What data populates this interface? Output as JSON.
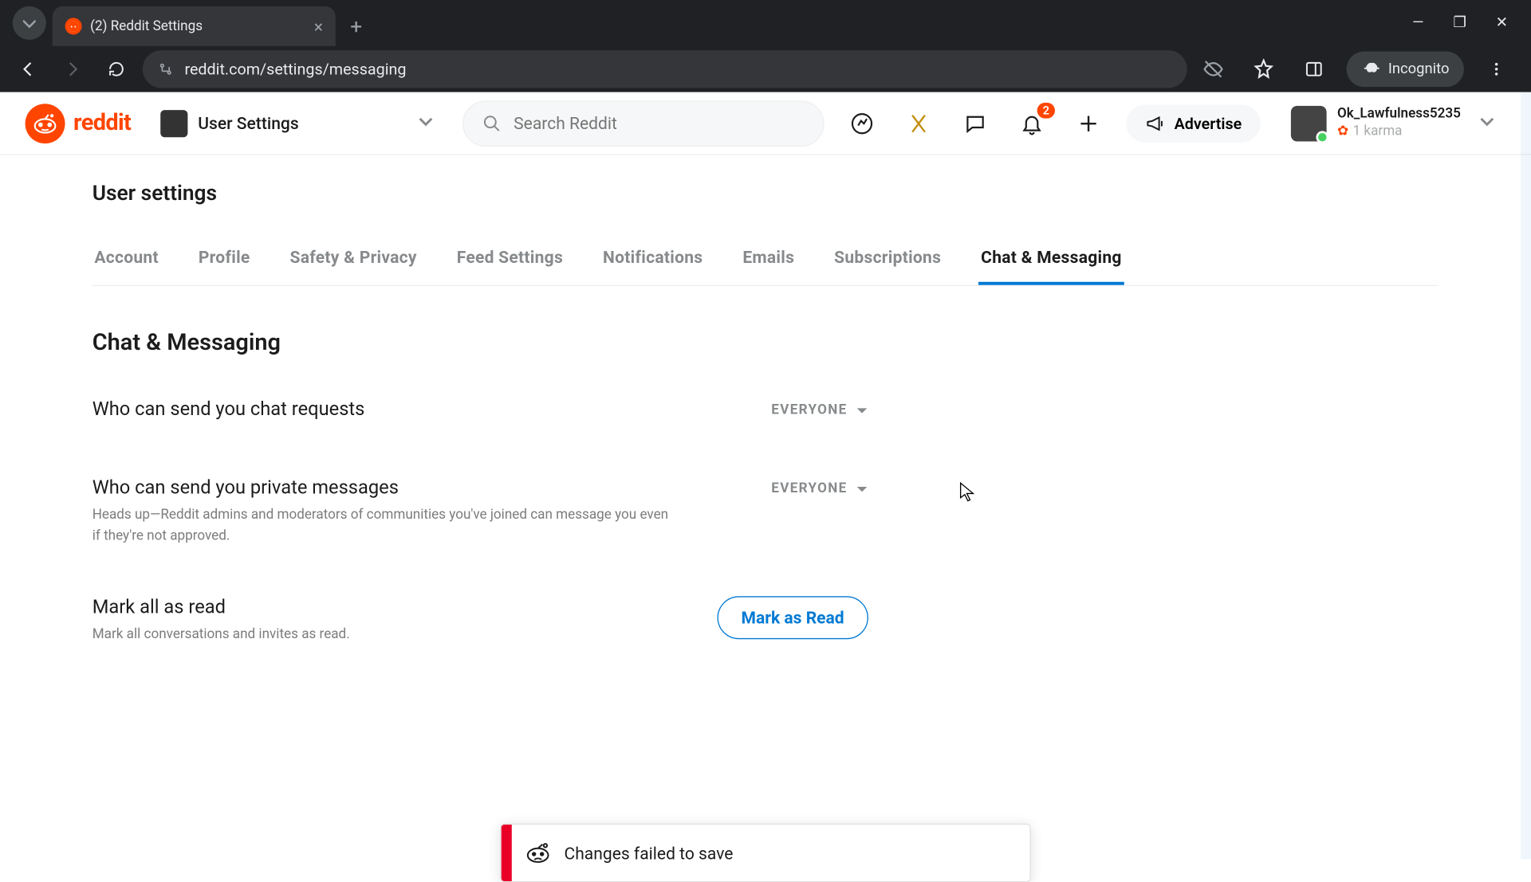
{
  "browser": {
    "tab_title": "(2) Reddit Settings",
    "url": "reddit.com/settings/messaging",
    "incognito_label": "Incognito"
  },
  "header": {
    "logo_text": "reddit",
    "nav_label": "User Settings",
    "search_placeholder": "Search Reddit",
    "notification_count": "2",
    "advertise_label": "Advertise",
    "user_name": "Ok_Lawfulness5235",
    "user_karma": "1 karma"
  },
  "page": {
    "title": "User settings",
    "tabs": [
      "Account",
      "Profile",
      "Safety & Privacy",
      "Feed Settings",
      "Notifications",
      "Emails",
      "Subscriptions",
      "Chat & Messaging"
    ],
    "active_tab_index": 7,
    "section_title": "Chat & Messaging",
    "settings": {
      "chat_requests": {
        "label": "Who can send you chat requests",
        "value": "EVERYONE"
      },
      "private_messages": {
        "label": "Who can send you private messages",
        "desc": "Heads up—Reddit admins and moderators of communities you've joined can message you even if they're not approved.",
        "value": "EVERYONE"
      },
      "mark_read": {
        "label": "Mark all as read",
        "desc": "Mark all conversations and invites as read.",
        "button": "Mark as Read"
      }
    },
    "toast": {
      "message": "Changes failed to save"
    }
  }
}
